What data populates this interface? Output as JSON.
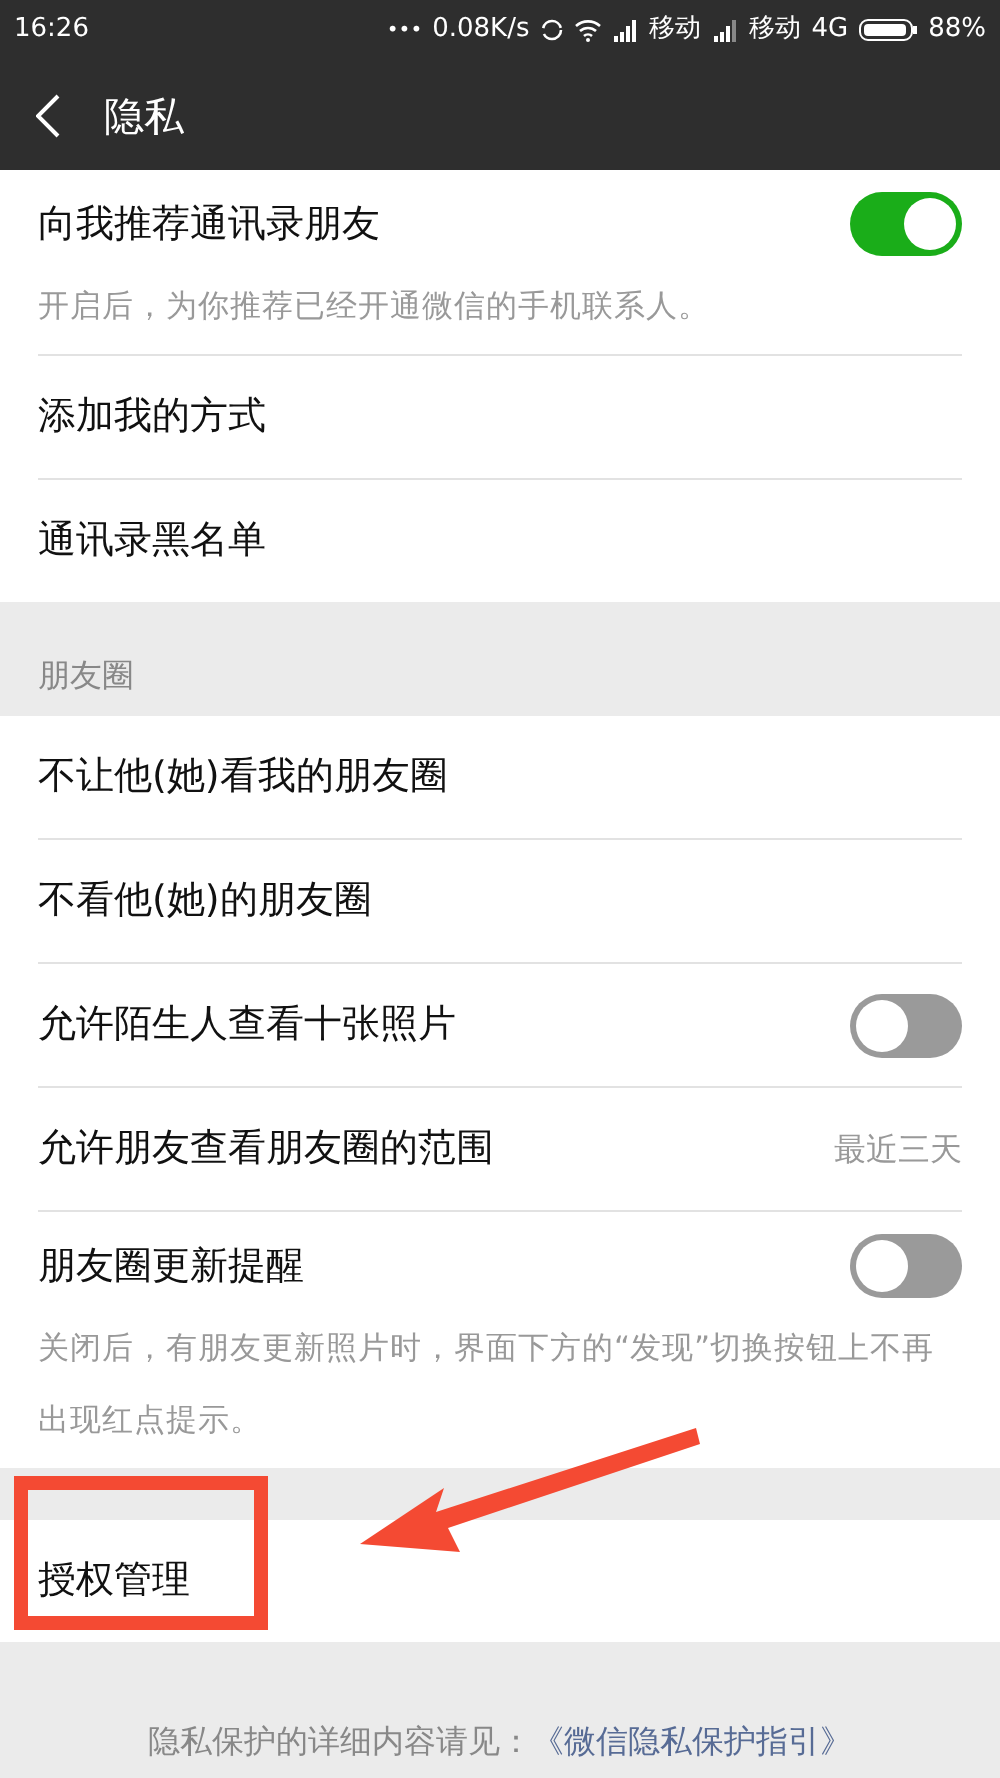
{
  "status_bar": {
    "time": "16:26",
    "dots": "•••",
    "speed": "0.08K/s",
    "carrier_1": "移动",
    "carrier_2": "移动",
    "network": "4G",
    "battery": "88%"
  },
  "header": {
    "title": "隐私"
  },
  "sections": [
    {
      "items": [
        {
          "kind": "toggle",
          "label": "向我推荐通讯录朋友",
          "on": true,
          "hint": "开启后，为你推荐已经开通微信的手机联系人。"
        },
        {
          "kind": "link",
          "label": "添加我的方式"
        },
        {
          "kind": "link",
          "label": "通讯录黑名单"
        }
      ]
    },
    {
      "title": "朋友圈",
      "items": [
        {
          "kind": "link",
          "label": "不让他(她)看我的朋友圈"
        },
        {
          "kind": "link",
          "label": "不看他(她)的朋友圈"
        },
        {
          "kind": "toggle",
          "label": "允许陌生人查看十张照片",
          "on": false
        },
        {
          "kind": "value",
          "label": "允许朋友查看朋友圈的范围",
          "value": "最近三天"
        },
        {
          "kind": "toggle",
          "label": "朋友圈更新提醒",
          "on": false,
          "hint": "关闭后，有朋友更新照片时，界面下方的“发现”切换按钮上不再出现红点提示。"
        }
      ]
    },
    {
      "items": [
        {
          "kind": "link",
          "label": "授权管理"
        }
      ]
    }
  ],
  "footer": {
    "text": "隐私保护的详细内容请见：",
    "link": "《微信隐私保护指引》"
  }
}
